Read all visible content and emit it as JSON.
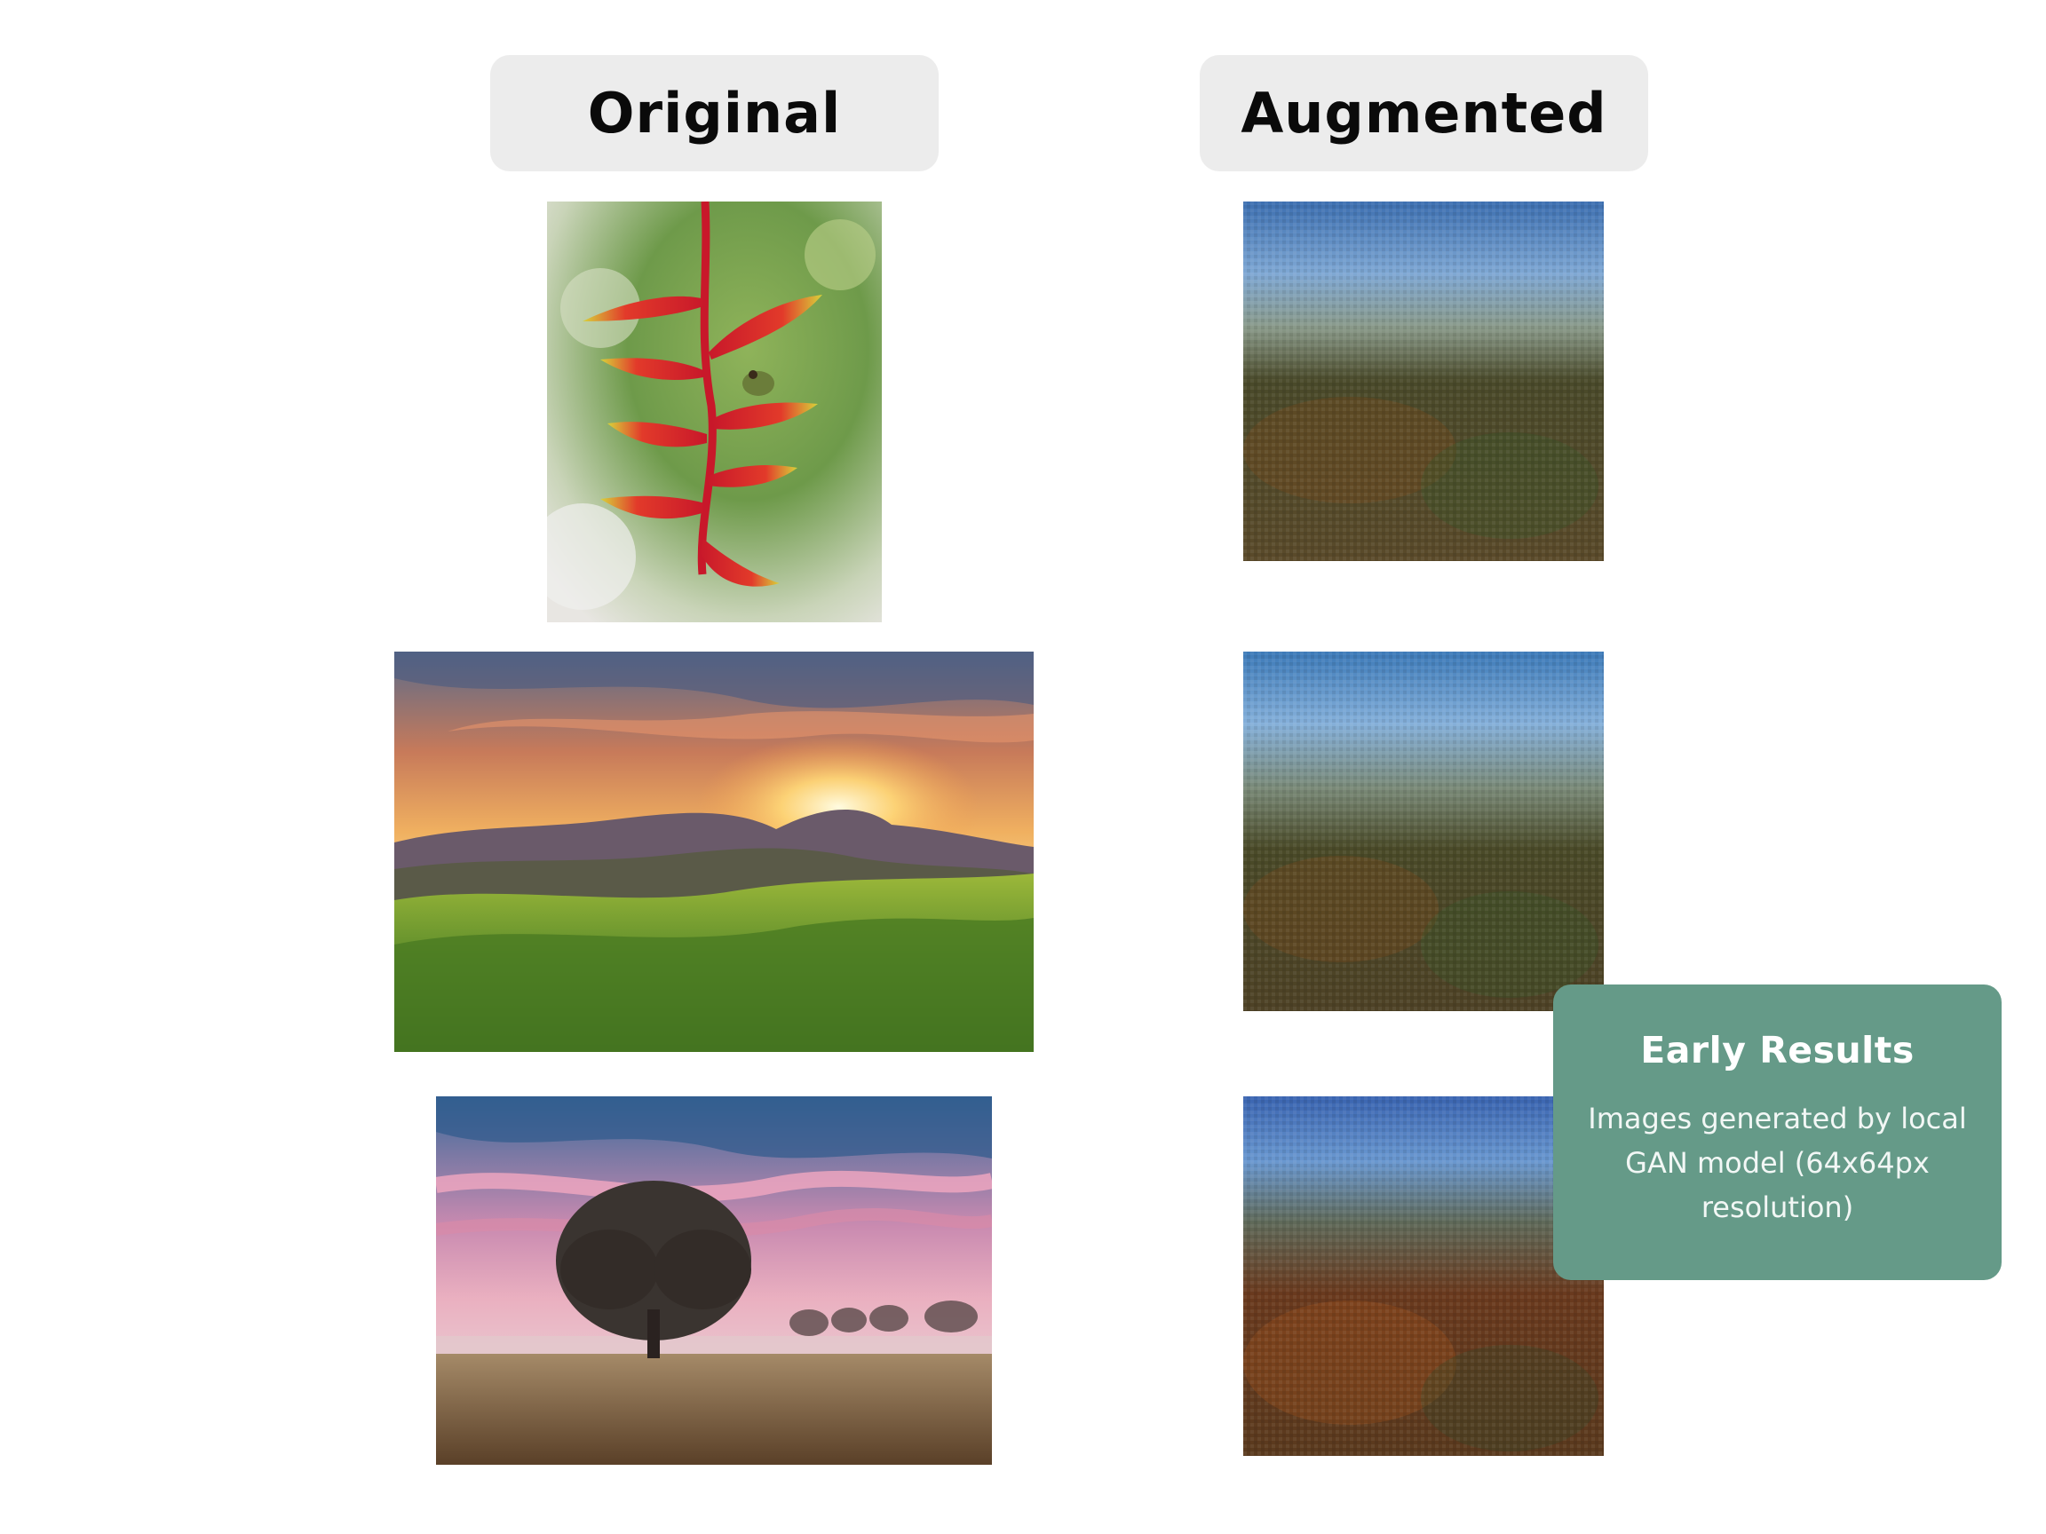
{
  "headers": {
    "original": "Original",
    "augmented": "Augmented"
  },
  "images": {
    "original": [
      {
        "subject": "red heliconia flower with small frog on blurred green background"
      },
      {
        "subject": "sunset over mountains with green grassy hillside"
      },
      {
        "subject": "lone tree in misty field under pink and blue sky"
      }
    ],
    "augmented": [
      {
        "subject": "GAN-generated blurry landscape with blue sky and brown-green ground"
      },
      {
        "subject": "GAN-generated blurry landscape with blue sky and brown-green ground"
      },
      {
        "subject": "GAN-generated blurry landscape with blue sky and brown-orange ground"
      }
    ]
  },
  "callout": {
    "title": "Early Results",
    "body": "Images generated by local GAN model (64x64px resolution)"
  },
  "colors": {
    "header_bg": "#ececec",
    "callout_bg": "#659a88",
    "page_bg": "#ffffff"
  }
}
